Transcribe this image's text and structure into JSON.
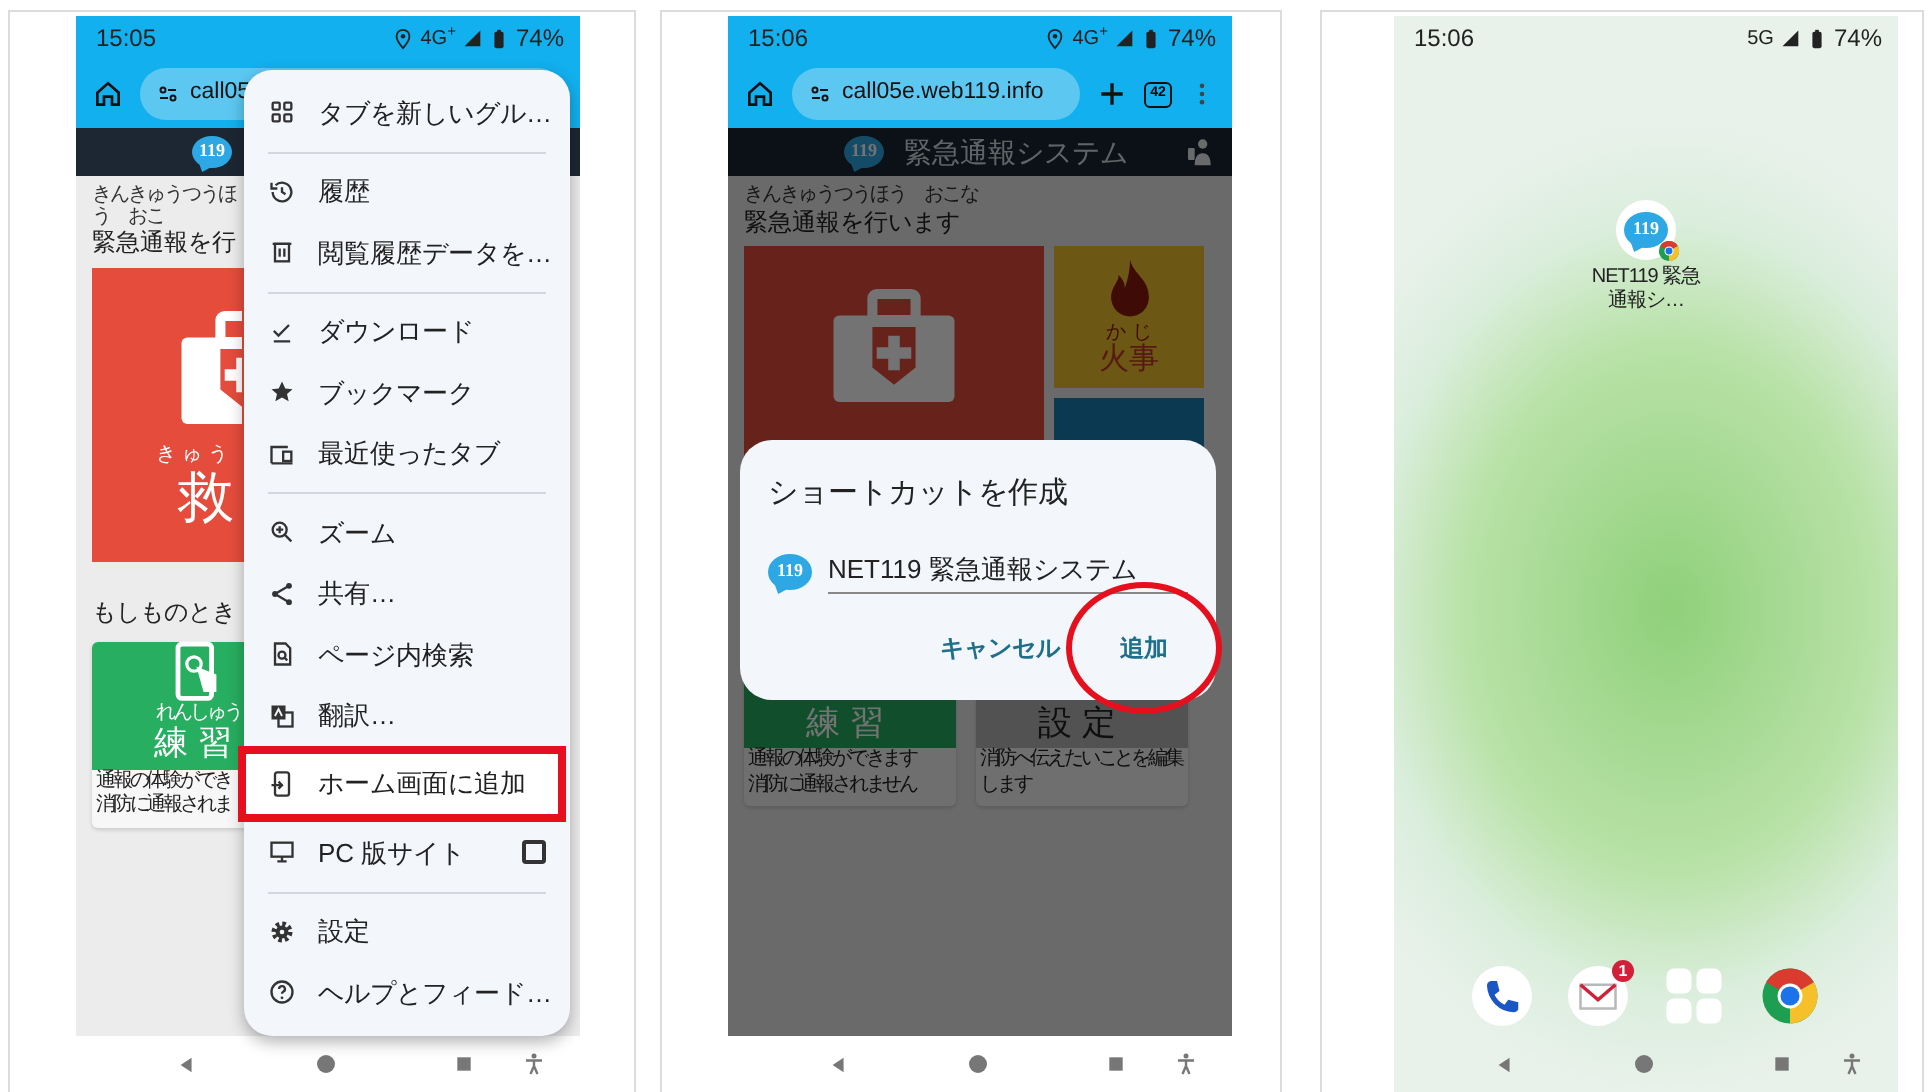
{
  "screens": [
    {
      "kind": "menu",
      "status_bar": {
        "time": "15:05",
        "location_icon": true,
        "network": "4G$^{+}$",
        "battery": "74%"
      },
      "toolbar": {
        "url": "call05"
      },
      "header": {
        "logo": "119"
      },
      "page": {
        "heading_ruby": "きんきゅうつうほう　おこ",
        "heading": "緊急通報を行",
        "main_card": {
          "ruby": "きゅう",
          "label": "救"
        },
        "section": "もしものとき",
        "sub_cards": [
          {
            "kind": "practice",
            "ruby": "れんしゅう",
            "label": "練習",
            "notes": [
              "通報の体験ができ",
              "消防に通報されま"
            ]
          }
        ]
      },
      "menu": {
        "groups": [
          [
            {
              "kind": "action",
              "label": "タブを新しいグル…",
              "highlighted": false
            }
          ],
          [
            {
              "kind": "action",
              "label": "履歴",
              "highlighted": false
            },
            {
              "kind": "action",
              "label": "閲覧履歴データを…",
              "highlighted": false
            }
          ],
          [
            {
              "kind": "action",
              "label": "ダウンロード",
              "highlighted": false
            },
            {
              "kind": "action",
              "label": "ブックマーク",
              "highlighted": false
            },
            {
              "kind": "action",
              "label": "最近使ったタブ",
              "highlighted": false
            }
          ],
          [
            {
              "kind": "action",
              "label": "ズーム",
              "highlighted": false
            },
            {
              "kind": "action",
              "label": "共有…",
              "highlighted": false
            },
            {
              "kind": "action",
              "label": "ページ内検索",
              "highlighted": false
            },
            {
              "kind": "action",
              "label": "翻訳…",
              "highlighted": false
            },
            {
              "kind": "action",
              "label": "ホーム画面に追加",
              "highlighted": true
            },
            {
              "kind": "checkbox",
              "label": "PC 版サイト",
              "highlighted": false,
              "checked": false
            }
          ],
          [
            {
              "kind": "action",
              "label": "設定",
              "highlighted": false
            },
            {
              "kind": "action",
              "label": "ヘルプとフィード…",
              "highlighted": false
            }
          ]
        ]
      }
    },
    {
      "kind": "dialog",
      "status_bar": {
        "time": "15:06",
        "location_icon": true,
        "network": "4G$^{+}$",
        "battery": "74%"
      },
      "toolbar": {
        "url": "call05e.web119.info",
        "tab_count": "42"
      },
      "header": {
        "logo": "119",
        "title": "緊急通報システム",
        "user_icon": true
      },
      "page": {
        "heading_ruby": "きんきゅうつうほう　おこな",
        "heading": "緊急通報を行います",
        "side_cards": [
          {
            "kind": "fire",
            "ruby": "か じ",
            "label": "火事"
          },
          {
            "kind": "house"
          }
        ],
        "sub_cards": [
          {
            "kind": "practice",
            "label": "練習",
            "notes": [
              "通報の体験ができます",
              "消防に通報されません"
            ]
          },
          {
            "kind": "settings",
            "label": "設定",
            "notes": [
              "消防へ伝えたいことを編集",
              "します"
            ]
          }
        ]
      },
      "dialog": {
        "title": "ショートカットを作成",
        "logo": "119",
        "name": "NET119 緊急通報システム",
        "buttons": [
          {
            "label": "キャンセル",
            "circled": false
          },
          {
            "label": "追加",
            "circled": true
          }
        ]
      }
    },
    {
      "kind": "home",
      "status_bar": {
        "time": "15:06",
        "location_icon": false,
        "network": "5G",
        "battery": "74%"
      },
      "shortcut": {
        "logo": "119",
        "label": "NET119 緊急通報シ…"
      },
      "dock": {
        "mail_badge": "1"
      }
    }
  ]
}
